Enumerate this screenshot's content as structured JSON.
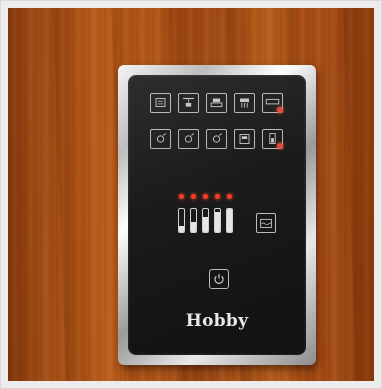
{
  "scene": {
    "description_colors": {
      "wood": "#a44c12",
      "panel": "#1b1b1b",
      "led": "#ff3b24",
      "warning": "#e34a3a"
    }
  },
  "control_panel": {
    "brand": "Hobby",
    "row1_buttons": [
      {
        "icon": "heater-icon",
        "warning": false
      },
      {
        "icon": "light-ceiling-icon",
        "warning": false
      },
      {
        "icon": "bed-light-icon",
        "warning": false
      },
      {
        "icon": "kitchen-light-icon",
        "warning": false
      },
      {
        "icon": "awning-light-icon",
        "warning": true
      }
    ],
    "row2_buttons": [
      {
        "icon": "dimmer-icon",
        "warning": false
      },
      {
        "icon": "dimmer-icon",
        "warning": false
      },
      {
        "icon": "dimmer-icon",
        "warning": false
      },
      {
        "icon": "cabinet-icon",
        "warning": false
      },
      {
        "icon": "battery-icon",
        "warning": true
      }
    ],
    "status_leds_lit": 5,
    "tank_levels": [
      0.25,
      0.45,
      0.65,
      0.85,
      1.0
    ],
    "power_icon": "power-icon",
    "tank_icon": "water-tank-icon"
  }
}
